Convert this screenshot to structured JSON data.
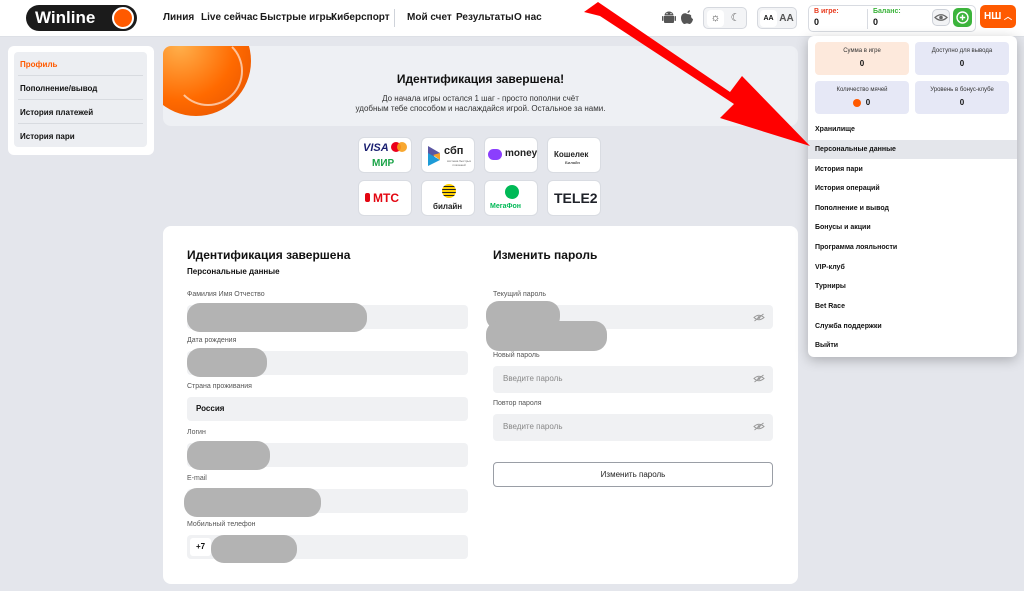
{
  "header": {
    "logo_text": "Winline",
    "nav": [
      "Линия",
      "Live сейчас",
      "Быстрые игры",
      "Киберспорт",
      "Мой счет",
      "Результаты",
      "О нас"
    ],
    "font_small": "AA",
    "font_large": "AA",
    "in_game_label": "В игре:",
    "in_game_value": "0",
    "balance_label": "Баланс:",
    "balance_value": "0",
    "user_initials": "НШ",
    "colors": {
      "brand": "#ff5a00",
      "green": "#3cb43c"
    }
  },
  "profile_menu": {
    "items": [
      "Профиль",
      "Пополнение/вывод",
      "История платежей",
      "История пари"
    ],
    "active_color": "#ff5a00"
  },
  "banner": {
    "title": "Идентификация завершена!",
    "line1": "До начала игры остался 1 шаг - просто пополни счёт",
    "line2": "удобным тебе способом и наслаждайся игрой. Остальное за нами."
  },
  "payments": {
    "visa": "VISA",
    "mir": "МИР",
    "sbp": "сбп",
    "sbp_sub": "система быстрых платежей",
    "umoney": "money",
    "koshelek": "Кошелек",
    "koshelek_sub": "Билайн",
    "mts": "МТС",
    "beeline": "билайн",
    "megafon": "МегаФон",
    "tele2": "TELE2"
  },
  "personal": {
    "title": "Идентификация завершена",
    "subtitle": "Персональные данные",
    "fio_label": "Фамилия Имя Отчество",
    "birth_label": "Дата рождения",
    "country_label": "Страна проживания",
    "country_value": "Россия",
    "login_label": "Логин",
    "email_label": "E-mail",
    "phone_label": "Мобильный телефон",
    "phone_prefix": "+7"
  },
  "password": {
    "title": "Изменить пароль",
    "current_label": "Текущий пароль",
    "new_label": "Новый пароль",
    "new_placeholder": "Введите пароль",
    "repeat_label": "Повтор пароля",
    "repeat_placeholder": "Введите пароль",
    "button": "Изменить пароль"
  },
  "dropdown": {
    "stats": [
      {
        "label": "Сумма в игре",
        "value": "0",
        "bg": "#fde9dc"
      },
      {
        "label": "Доступно для вывода",
        "value": "0",
        "bg": "#e6e8f6"
      },
      {
        "label": "Количество мячей",
        "value": "0",
        "bg": "#e6e8f6"
      },
      {
        "label": "Уровень в бонус-клубе",
        "value": "0",
        "bg": "#e6e8f6"
      }
    ],
    "items": [
      "Хранилище",
      "Персональные данные",
      "История пари",
      "История операций",
      "Пополнение и вывод",
      "Бонусы и акции",
      "Программа лояльности",
      "VIP-клуб",
      "Турниры",
      "Bet Race",
      "Служба поддержки",
      "Выйти"
    ],
    "active_index": 1
  },
  "annotation_color": "#ff0000"
}
